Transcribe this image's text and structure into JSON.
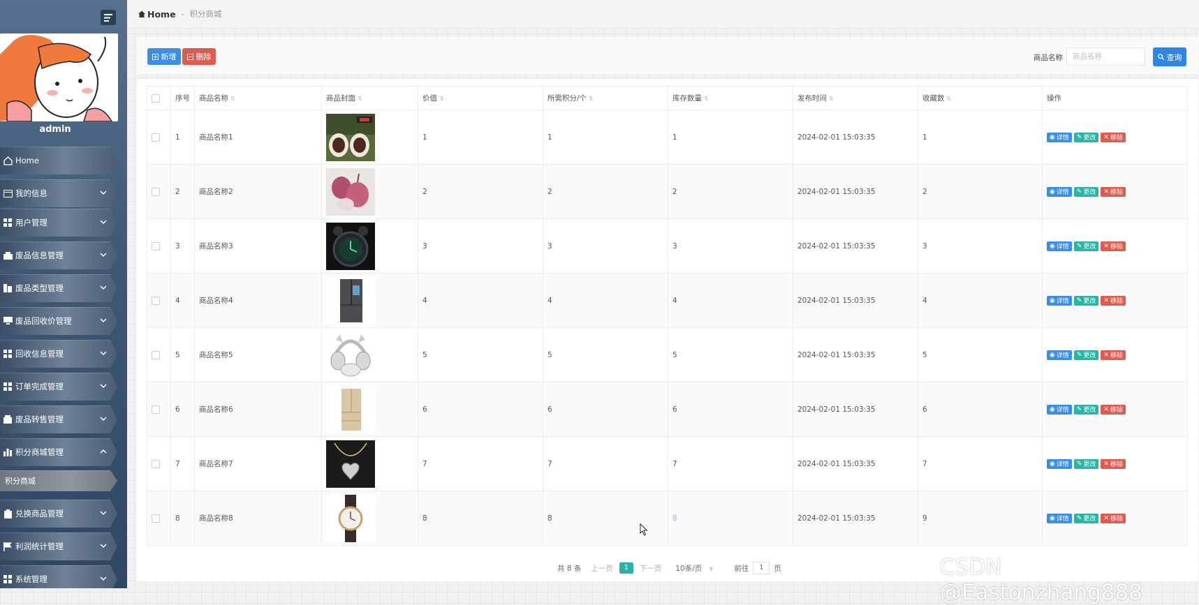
{
  "sidebar": {
    "user_name": "admin",
    "menu": [
      {
        "label": "Home",
        "icon": "home-icon",
        "expandable": false
      },
      {
        "label": "我的信息",
        "icon": "card-icon",
        "expandable": true
      },
      {
        "label": "用户管理",
        "icon": "grid-icon",
        "expandable": true
      },
      {
        "label": "废品信息管理",
        "icon": "money-icon",
        "expandable": true
      },
      {
        "label": "废品类型管理",
        "icon": "building-icon",
        "expandable": true
      },
      {
        "label": "废品回收价管理",
        "icon": "monitor-icon",
        "expandable": true
      },
      {
        "label": "回收信息管理",
        "icon": "grid-icon",
        "expandable": true
      },
      {
        "label": "订单完成管理",
        "icon": "grid-icon",
        "expandable": true
      },
      {
        "label": "废品转售管理",
        "icon": "box-icon",
        "expandable": true
      },
      {
        "label": "积分商城管理",
        "icon": "bar-chart-icon",
        "expandable": true,
        "expanded": true
      },
      {
        "label": "积分商城",
        "sub": true
      },
      {
        "label": "兑换商品管理",
        "icon": "clipboard-icon",
        "expandable": true
      },
      {
        "label": "利润统计管理",
        "icon": "flag-icon",
        "expandable": true
      },
      {
        "label": "系统管理",
        "icon": "grid-icon",
        "expandable": true
      }
    ]
  },
  "breadcrumb": {
    "home": "Home",
    "separator": "-",
    "current": "积分商城"
  },
  "toolbar": {
    "add_label": "新增",
    "delete_label": "删除",
    "search_label": "商品名称",
    "search_placeholder": "商品名称",
    "query_label": "查询"
  },
  "table": {
    "columns": [
      "序号",
      "商品名称",
      "商品封面",
      "价值",
      "所需积分/个",
      "库存数量",
      "发布时间",
      "收藏数",
      "操作"
    ],
    "rows": [
      {
        "no": "1",
        "name": "商品名称1",
        "image": "speakers",
        "value": "1",
        "points": "1",
        "stock": "1",
        "time": "2024-02-01 15:03:35",
        "fav": "1"
      },
      {
        "no": "2",
        "name": "商品名称2",
        "image": "onions",
        "value": "2",
        "points": "2",
        "stock": "2",
        "time": "2024-02-01 15:03:35",
        "fav": "2"
      },
      {
        "no": "3",
        "name": "商品名称3",
        "image": "alarm-clock",
        "value": "3",
        "points": "3",
        "stock": "3",
        "time": "2024-02-01 15:03:35",
        "fav": "3"
      },
      {
        "no": "4",
        "name": "商品名称4",
        "image": "fridge-dark",
        "value": "4",
        "points": "4",
        "stock": "4",
        "time": "2024-02-01 15:03:35",
        "fav": "4"
      },
      {
        "no": "5",
        "name": "商品名称5",
        "image": "cat-headphones",
        "value": "5",
        "points": "5",
        "stock": "5",
        "time": "2024-02-01 15:03:35",
        "fav": "5"
      },
      {
        "no": "6",
        "name": "商品名称6",
        "image": "fridge-gold",
        "value": "6",
        "points": "6",
        "stock": "6",
        "time": "2024-02-01 15:03:35",
        "fav": "6"
      },
      {
        "no": "7",
        "name": "商品名称7",
        "image": "heart-necklace",
        "value": "7",
        "points": "7",
        "stock": "7",
        "time": "2024-02-01 15:03:35",
        "fav": "7"
      },
      {
        "no": "8",
        "name": "商品名称8",
        "image": "wristwatch",
        "value": "8",
        "points": "8",
        "stock": "8",
        "time": "2024-02-01 15:03:35",
        "fav": "9"
      }
    ],
    "actions": {
      "detail": "详情",
      "edit": "更改",
      "remove": "移除"
    }
  },
  "pagination": {
    "total": "共 8 条",
    "prev": "上一页",
    "current": "1",
    "next": "下一页",
    "page_size": "10条/页",
    "goto_label": "前往",
    "goto_value": "1",
    "goto_unit": "页"
  },
  "watermark": "CSDN @Eastonzhang888",
  "colors": {
    "primary": "#3a8ee6",
    "danger": "#e05b4f",
    "teal": "#2bb3a3",
    "sidebar": "#3f5874"
  }
}
